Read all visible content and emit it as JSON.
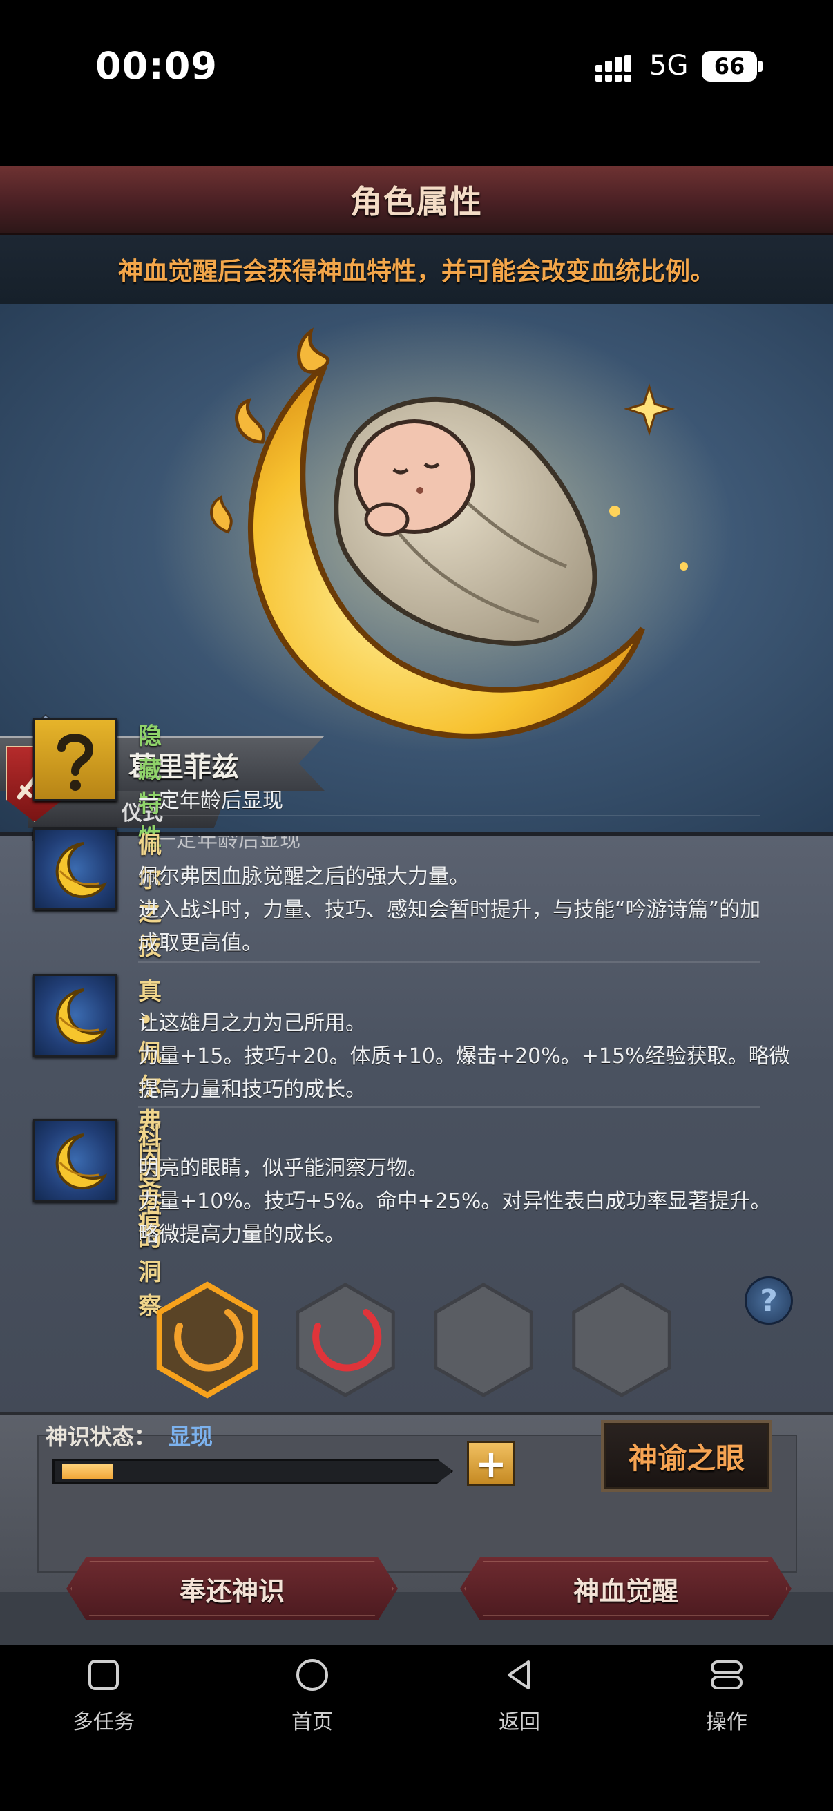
{
  "status_bar": {
    "time": "00:09",
    "network": "5G",
    "battery": "66"
  },
  "header": {
    "title": "角色属性",
    "hint": "神血觉醒后会获得神血特性，并可能会改变血统比例。"
  },
  "character": {
    "name": "葛里菲兹",
    "subtitle": "仪式"
  },
  "traits": {
    "cut_off_text": "一定年龄后显现",
    "items": [
      {
        "title": "隐藏特性",
        "title_color": "#8fd36a",
        "icon": "question-icon",
        "lines": [
          "",
          "一定年龄后显现"
        ]
      },
      {
        "title": "佩尔之技",
        "title_color": "#f0d58c",
        "icon": "crescent-moon-icon",
        "lines": [
          "佩尔弗因血脉觉醒之后的强大力量。",
          "进入战斗时，力量、技巧、感知会暂时提升，与技能“吟游诗篇”的加",
          "成取更高值。"
        ]
      },
      {
        "title": "真•佩尔弗因圣痕",
        "title_color": "#f0d58c",
        "icon": "crescent-moon-icon",
        "lines": [
          "让这雄月之力为己所用。",
          "力量+15。技巧+20。体质+10。爆击+20%。+15%经验获取。略微",
          "提高力量和技巧的成长。"
        ]
      },
      {
        "title": "科内塔的洞察",
        "title_color": "#f0d58c",
        "icon": "crescent-moon-icon",
        "lines": [
          "明亮的眼睛，似乎能洞察万物。",
          "力量+10%。技巧+5%。命中+25%。对异性表白成功率显著提升。",
          "略微提高力量的成长。"
        ]
      }
    ]
  },
  "divine": {
    "help_label": "?",
    "status_label": "神识状态：",
    "status_value": "显现",
    "progress": 0.13,
    "plus_label": "+",
    "oracle_button": "神谕之眼",
    "slots": [
      {
        "state": "active",
        "color": "#f3a12b"
      },
      {
        "state": "filled",
        "color": "#e0343a"
      },
      {
        "state": "empty",
        "color": ""
      },
      {
        "state": "empty",
        "color": ""
      }
    ]
  },
  "actions": {
    "return_label": "奉还神识",
    "awaken_label": "神血觉醒"
  },
  "nav": {
    "items": [
      {
        "label": "多任务",
        "icon": "square-icon"
      },
      {
        "label": "首页",
        "icon": "circle-icon"
      },
      {
        "label": "返回",
        "icon": "back-triangle-icon"
      },
      {
        "label": "操作",
        "icon": "menu-pill-icon"
      }
    ]
  }
}
